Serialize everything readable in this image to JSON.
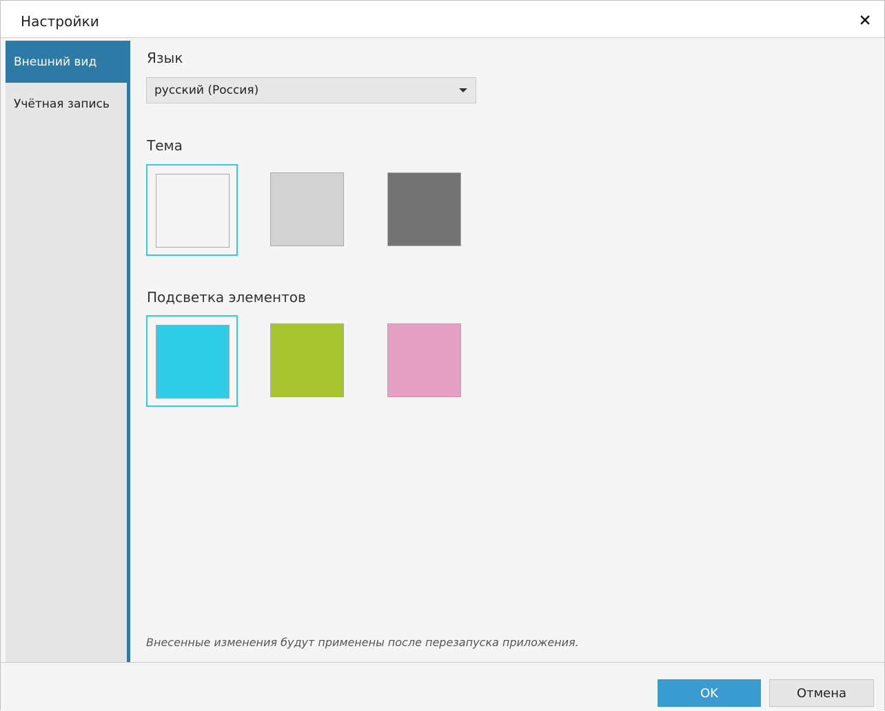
{
  "window": {
    "title": "Настройки"
  },
  "sidebar": {
    "items": [
      {
        "label": "Внешний вид",
        "active": true
      },
      {
        "label": "Учётная запись",
        "active": false
      }
    ]
  },
  "appearance": {
    "language_label": "Язык",
    "language_value": "русский (Россия)",
    "theme_label": "Тема",
    "theme_swatches": [
      "#f5f5f5",
      "#d2d2d2",
      "#737373"
    ],
    "theme_selected": 0,
    "highlight_label": "Подсветка элементов",
    "highlight_swatches": [
      "#2ecce6",
      "#a8c42e",
      "#e6a0c4"
    ],
    "highlight_selected": 0,
    "note": "Внесенные изменения будут применены после перезапуска приложения."
  },
  "footer": {
    "ok_label": "OK",
    "cancel_label": "Отмена"
  },
  "colors": {
    "accent": "#2e7aa6",
    "ok_button": "#3a9bd1",
    "selection_border": "#2ecce6"
  }
}
